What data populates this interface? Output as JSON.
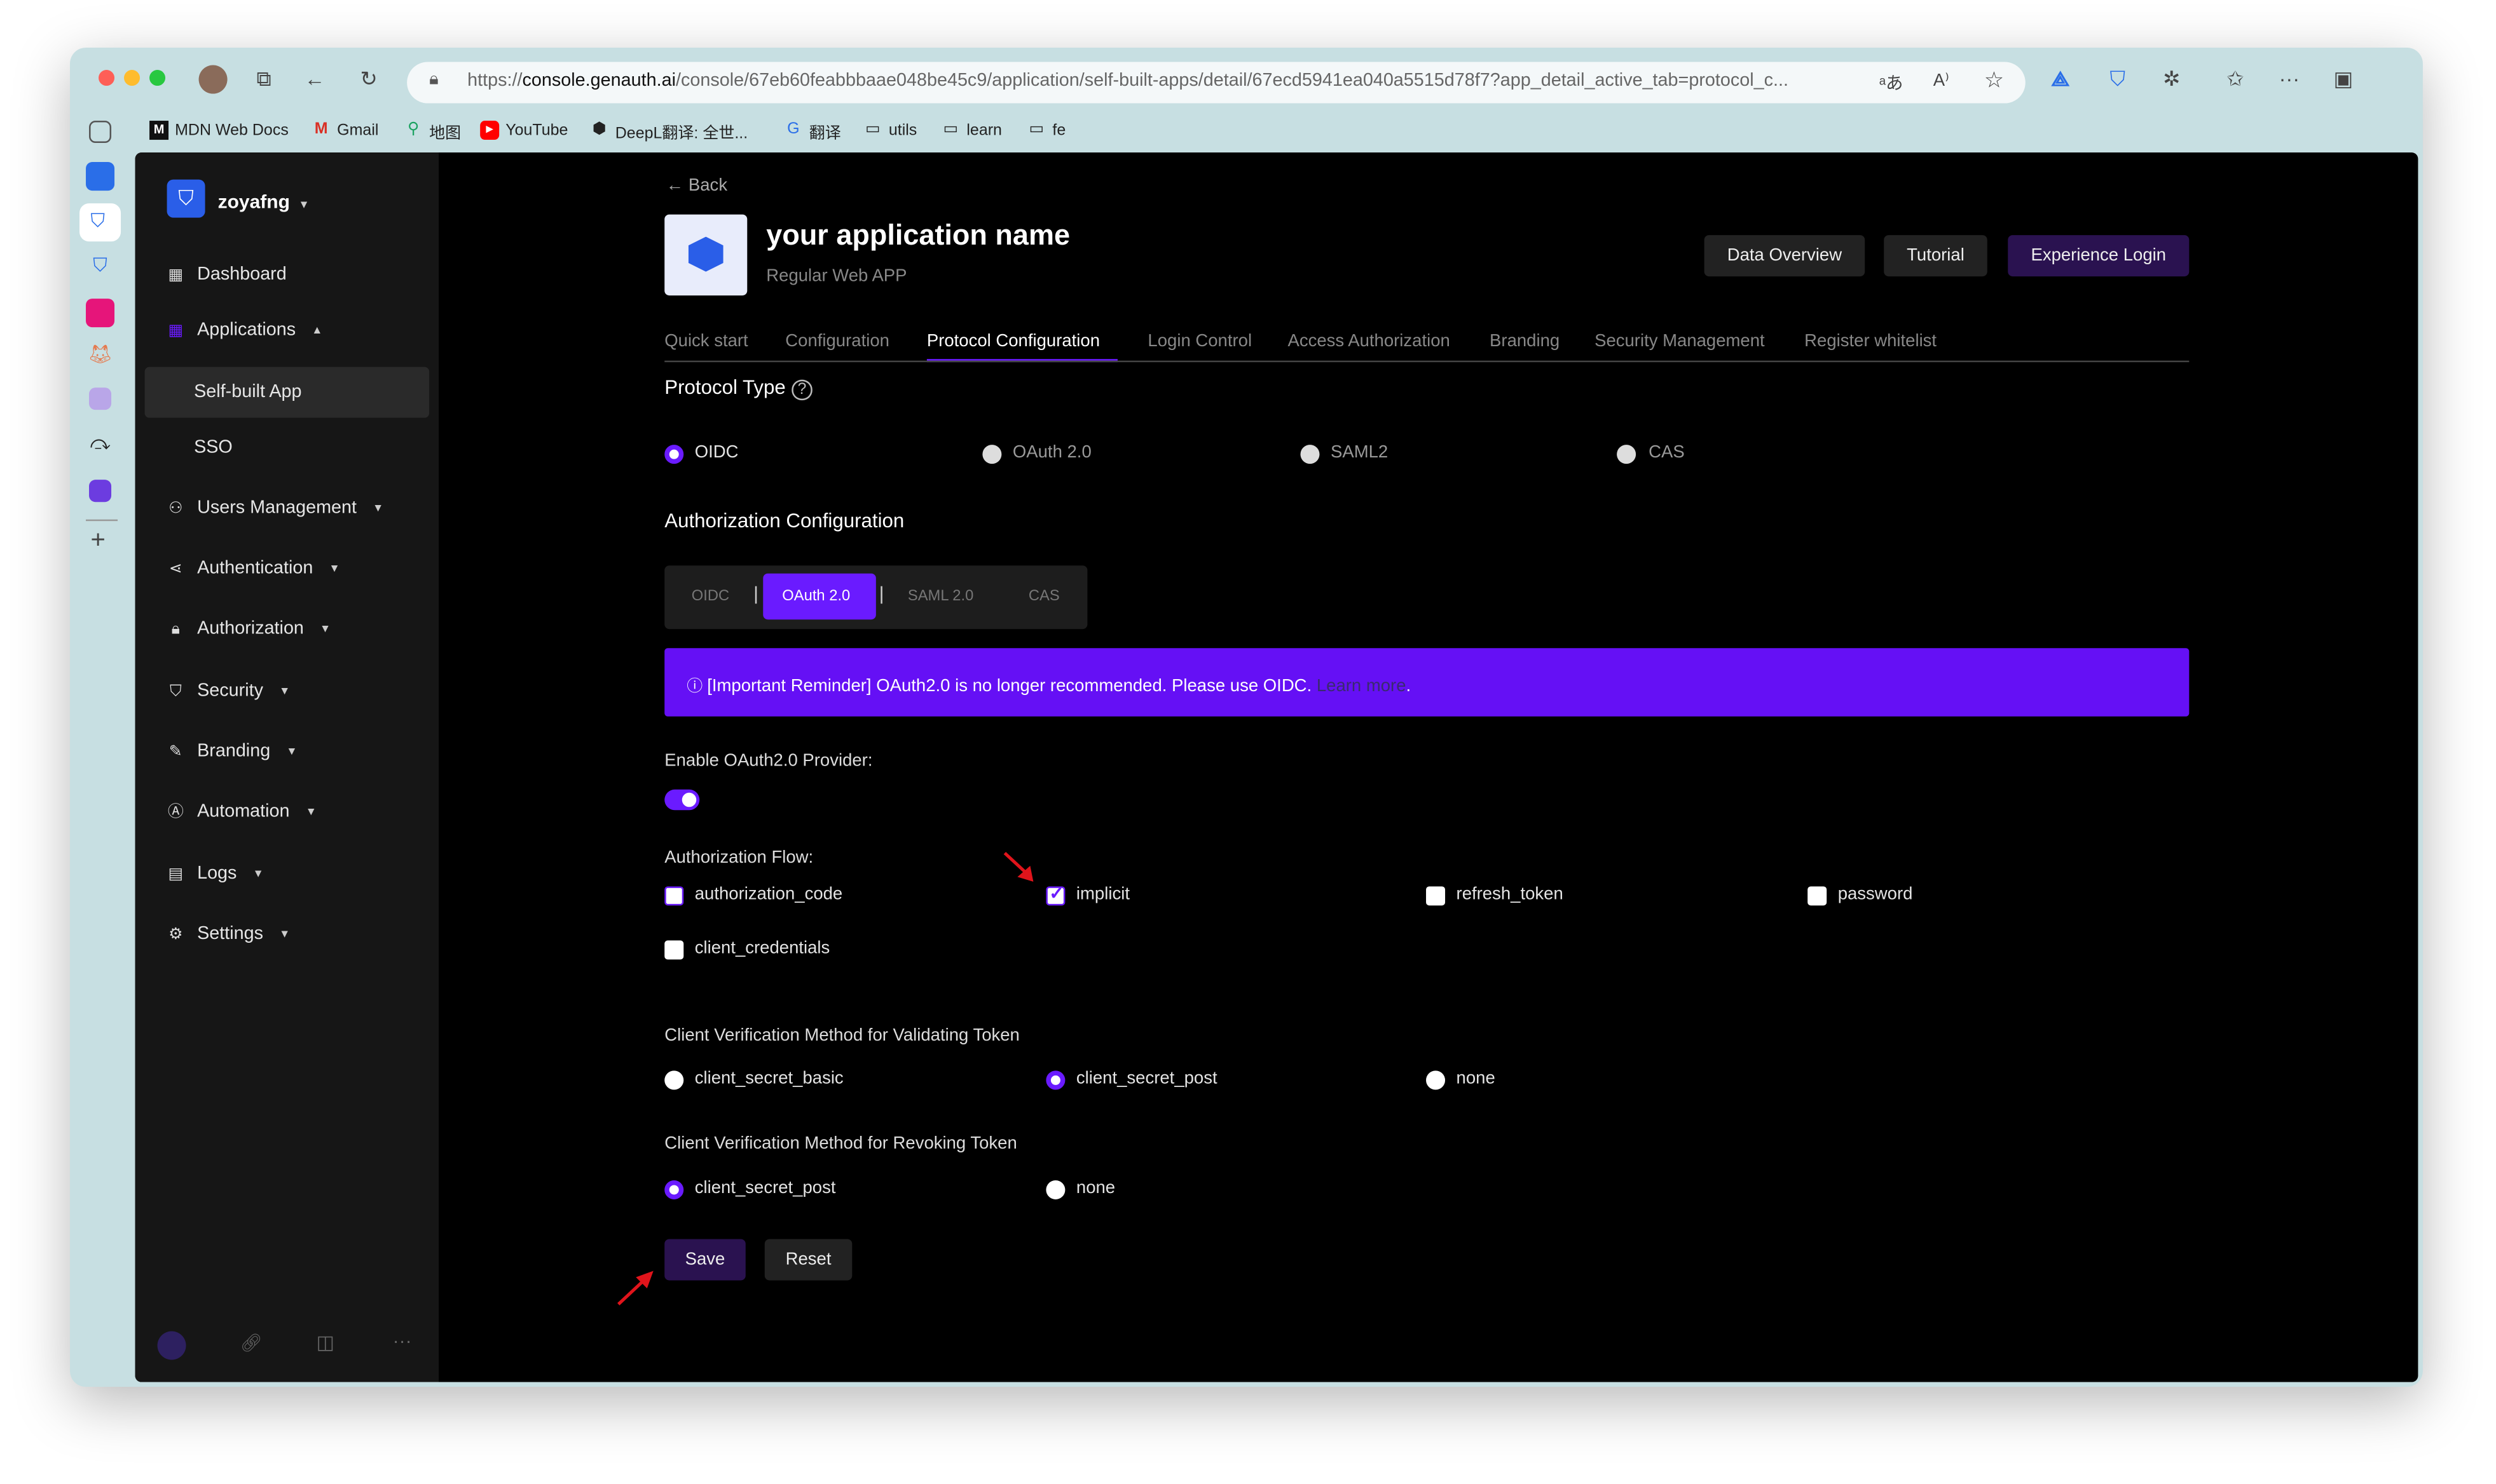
{
  "browser": {
    "url_prefix": "https://",
    "url_domain": "console.genauth.ai",
    "url_path": "/console/67eb60feabbbaae048be45c9/application/self-built-apps/detail/67ecd5941ea040a5515d78f7?app_detail_active_tab=protocol_c...",
    "bookmarks": [
      "MDN Web Docs",
      "Gmail",
      "地图",
      "YouTube",
      "DeepL翻译: 全世...",
      "翻译",
      "utils",
      "learn",
      "fe"
    ]
  },
  "sidebar": {
    "org_name": "zoyafng",
    "items": {
      "dashboard": "Dashboard",
      "applications": "Applications",
      "self_built": "Self-built App",
      "sso": "SSO",
      "users": "Users Management",
      "authentication": "Authentication",
      "authorization": "Authorization",
      "security": "Security",
      "branding": "Branding",
      "automation": "Automation",
      "logs": "Logs",
      "settings": "Settings"
    }
  },
  "header": {
    "back": "Back",
    "app_name": "your application name",
    "app_type": "Regular Web APP",
    "data_overview": "Data Overview",
    "tutorial": "Tutorial",
    "experience_login": "Experience Login"
  },
  "tabs": [
    "Quick start",
    "Configuration",
    "Protocol Configuration",
    "Login Control",
    "Access Authorization",
    "Branding",
    "Security Management",
    "Register whitelist"
  ],
  "protocol": {
    "title": "Protocol Type",
    "options": [
      "OIDC",
      "OAuth 2.0",
      "SAML2",
      "CAS"
    ]
  },
  "auth_config": {
    "title": "Authorization Configuration",
    "segments": [
      "OIDC",
      "OAuth 2.0",
      "SAML 2.0",
      "CAS"
    ]
  },
  "reminder": {
    "text": "[Important Reminder] OAuth2.0 is no longer recommended. Please use OIDC.",
    "link": "Learn more",
    "suffix": "."
  },
  "enable_provider": {
    "label": "Enable OAuth2.0 Provider:",
    "enabled": true
  },
  "auth_flow": {
    "label": "Authorization Flow:",
    "options": [
      "authorization_code",
      "implicit",
      "refresh_token",
      "password",
      "client_credentials"
    ],
    "checked": [
      "implicit"
    ]
  },
  "validate_method": {
    "label": "Client Verification Method for Validating Token",
    "options": [
      "client_secret_basic",
      "client_secret_post",
      "none"
    ],
    "selected": "client_secret_post"
  },
  "revoke_method": {
    "label": "Client Verification Method for Revoking Token",
    "options": [
      "client_secret_post",
      "none"
    ],
    "selected": "client_secret_post"
  },
  "actions": {
    "save": "Save",
    "reset": "Reset"
  },
  "colors": {
    "accent": "#6a1bff",
    "banner": "#6510f5",
    "annotation_arrow": "#e0141b"
  }
}
